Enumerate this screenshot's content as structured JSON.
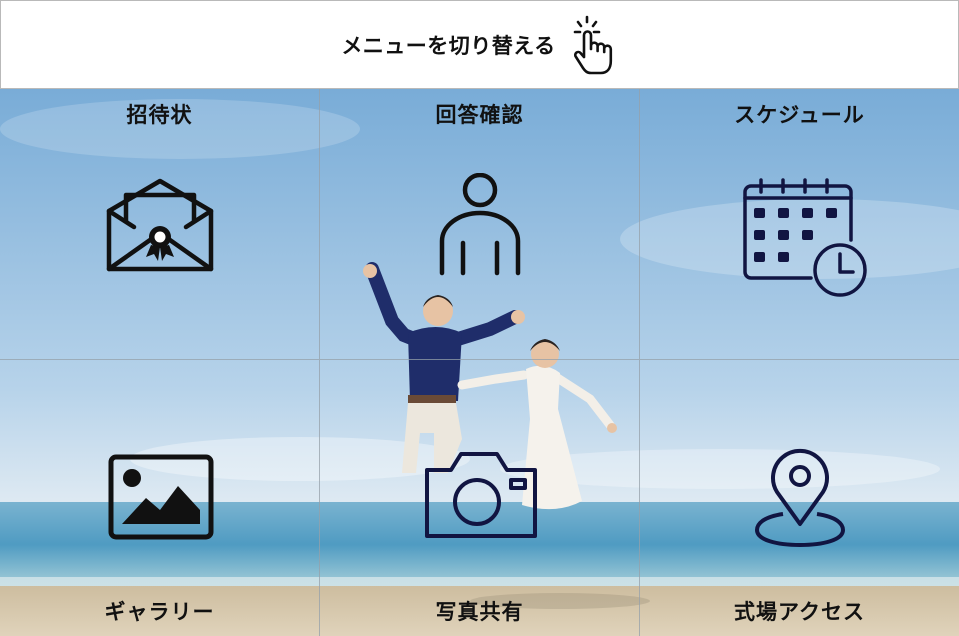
{
  "header": {
    "title": "メニューを切り替える",
    "icon": "tap-hand-icon"
  },
  "menu": {
    "items": [
      {
        "label": "招待状",
        "icon": "invitation-envelope-icon"
      },
      {
        "label": "回答確認",
        "icon": "person-icon"
      },
      {
        "label": "スケジュール",
        "icon": "calendar-clock-icon"
      },
      {
        "label": "ギャラリー",
        "icon": "image-gallery-icon"
      },
      {
        "label": "写真共有",
        "icon": "camera-icon"
      },
      {
        "label": "式場アクセス",
        "icon": "map-pin-icon"
      }
    ]
  },
  "background": {
    "description_icon": "beach-couple-photo",
    "colors": {
      "sky_top": "#7fb2db",
      "sky_bottom": "#d8e8f3",
      "sea": "#5aa2c8",
      "sand": "#d8c9ad",
      "navy": "#1b1f5e"
    }
  }
}
